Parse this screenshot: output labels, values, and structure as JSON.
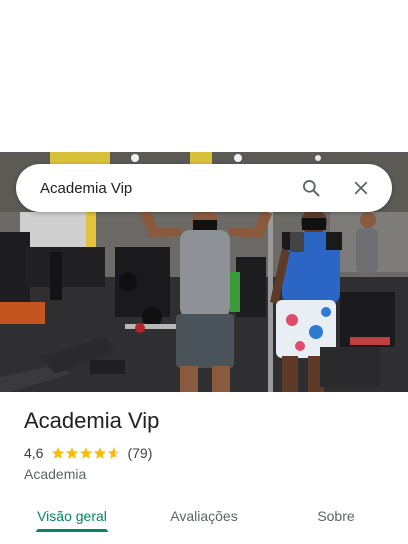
{
  "search": {
    "query": "Academia Vip"
  },
  "place": {
    "name": "Academia Vip",
    "rating": "4,6",
    "rating_value": 4.6,
    "reviews_count": "(79)",
    "category": "Academia"
  },
  "tabs": [
    {
      "label": "Visão geral",
      "active": true
    },
    {
      "label": "Avaliações",
      "active": false
    },
    {
      "label": "Sobre",
      "active": false
    }
  ],
  "colors": {
    "accent": "#01875f",
    "star": "#fbbc04",
    "text": "#202124"
  },
  "icons": {
    "search": "search-icon",
    "close": "close-icon",
    "star": "star-icon"
  }
}
